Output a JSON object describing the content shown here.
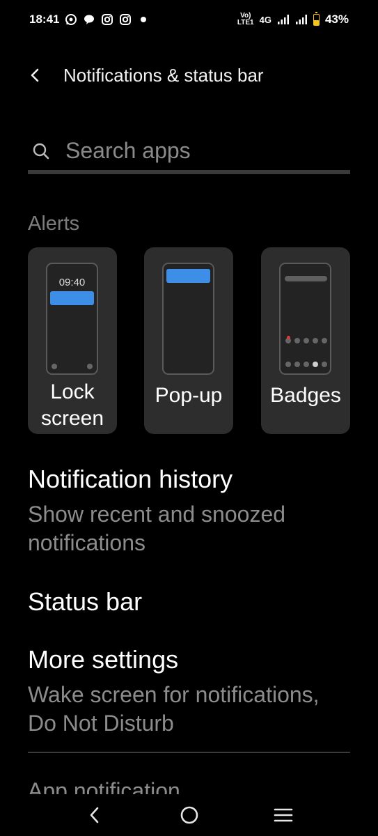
{
  "status_bar": {
    "time": "18:41",
    "left_icons": [
      "whatsapp-icon",
      "message-bubble-icon",
      "instagram-icon",
      "instagram-icon",
      "dot-icon"
    ],
    "network_lines": [
      "Vo)",
      "LTE1"
    ],
    "network_type": "4G",
    "battery_percent": "43%",
    "battery_level": 0.43,
    "battery_color": "#f5c518"
  },
  "header": {
    "title": "Notifications & status bar",
    "back_icon": "chevron-left-icon"
  },
  "search": {
    "placeholder": "Search apps",
    "value": "",
    "icon": "search-icon"
  },
  "alerts": {
    "label": "Alerts",
    "accent_color": "#3d8ee6",
    "cards": [
      {
        "label_line1": "Lock",
        "label_line2": "screen",
        "preview_time": "09:40"
      },
      {
        "label": "Pop-up"
      },
      {
        "label": "Badges"
      }
    ]
  },
  "items": {
    "history": {
      "title": "Notification history",
      "subtitle_line1": "Show recent and snoozed",
      "subtitle_line2": "notifications"
    },
    "status_bar": {
      "title": "Status bar"
    },
    "more": {
      "title": "More settings",
      "subtitle_line1": "Wake screen for notifications,",
      "subtitle_line2": "Do Not Disturb"
    },
    "partial": {
      "title": "App notification"
    }
  },
  "nav": {
    "back_icon": "nav-back-icon",
    "home_icon": "nav-home-icon",
    "menu_icon": "nav-menu-icon"
  }
}
